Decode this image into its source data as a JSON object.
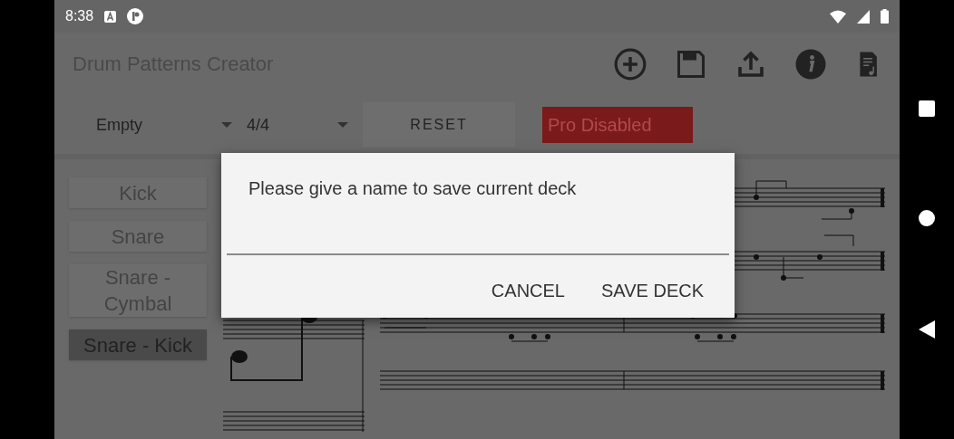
{
  "status_bar": {
    "time": "8:38"
  },
  "app_bar": {
    "title": "Drum Patterns Creator"
  },
  "controls": {
    "pattern": "Empty",
    "time_signature": "4/4",
    "reset": "RESET",
    "pro_status": "Pro Disabled"
  },
  "instruments": [
    {
      "label": "Kick",
      "selected": false
    },
    {
      "label": "Snare",
      "selected": false
    },
    {
      "label": "Snare - Cymbal",
      "selected": false
    },
    {
      "label": "Snare - Kick",
      "selected": true
    }
  ],
  "dialog": {
    "message": "Please give a name to save current deck",
    "buttons": [
      "CANCEL",
      "SAVE DECK"
    ]
  }
}
